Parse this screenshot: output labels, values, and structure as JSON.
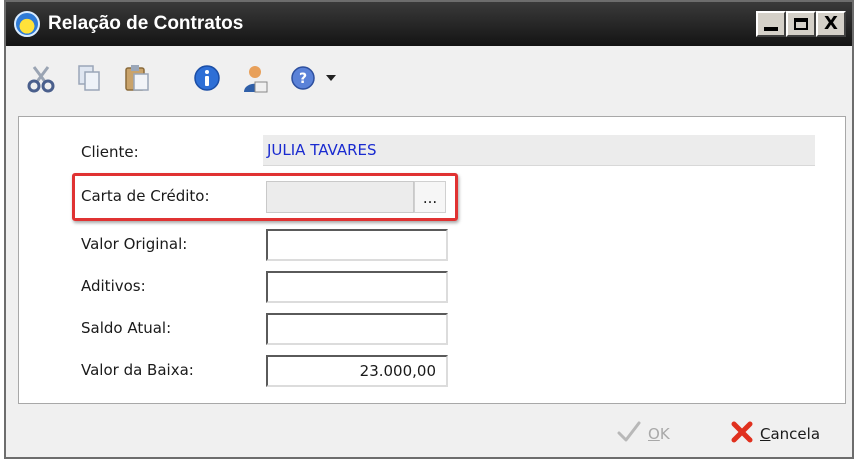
{
  "window": {
    "title": "Relação de Contratos",
    "controls": {
      "minimize": "_",
      "maximize": "□",
      "close": "X"
    }
  },
  "toolbar": {
    "icons": [
      "cut-icon",
      "copy-icon",
      "paste-icon",
      "info-icon",
      "user-icon",
      "help-icon",
      "dropdown-arrow-icon"
    ]
  },
  "form": {
    "cliente": {
      "label": "Cliente:",
      "value": "JULIA TAVARES",
      "value_color": "#1a2bd0"
    },
    "carta_credito": {
      "label": "Carta de Crédito:",
      "value": "",
      "button": "..."
    },
    "valor_original": {
      "label": "Valor Original:",
      "value": ""
    },
    "aditivos": {
      "label": "Aditivos:",
      "value": ""
    },
    "saldo_atual": {
      "label": "Saldo Atual:",
      "value": ""
    },
    "valor_baixa": {
      "label": "Valor da Baixa:",
      "value": "23.000,00"
    }
  },
  "footer": {
    "ok": {
      "underline": "O",
      "rest": "K"
    },
    "cancel": {
      "underline": "C",
      "rest": "ancela"
    }
  },
  "colors": {
    "highlight": "#e03232",
    "titlebar": "#141414",
    "link_blue": "#1a2bd0"
  }
}
